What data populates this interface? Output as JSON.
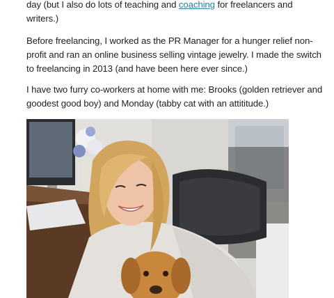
{
  "bio": {
    "line1_pre": "day (but I also do lots of teaching and ",
    "coaching_link": "coaching",
    "line1_post": " for freelancers and writers.)",
    "paragraph2": "Before freelancing, I worked as the PR Manager for a hunger relief non-profit and ran an online business selling vintage jewelry. I made the switch to freelancing in 2013 (and have been here ever since.)",
    "paragraph3": "I have two furry co-workers at home with me: Brooks (golden retriever and goodest good boy) and Monday (tabby cat with an attititude.)"
  },
  "colors": {
    "link": "#2a7fa6",
    "text": "#222222"
  }
}
